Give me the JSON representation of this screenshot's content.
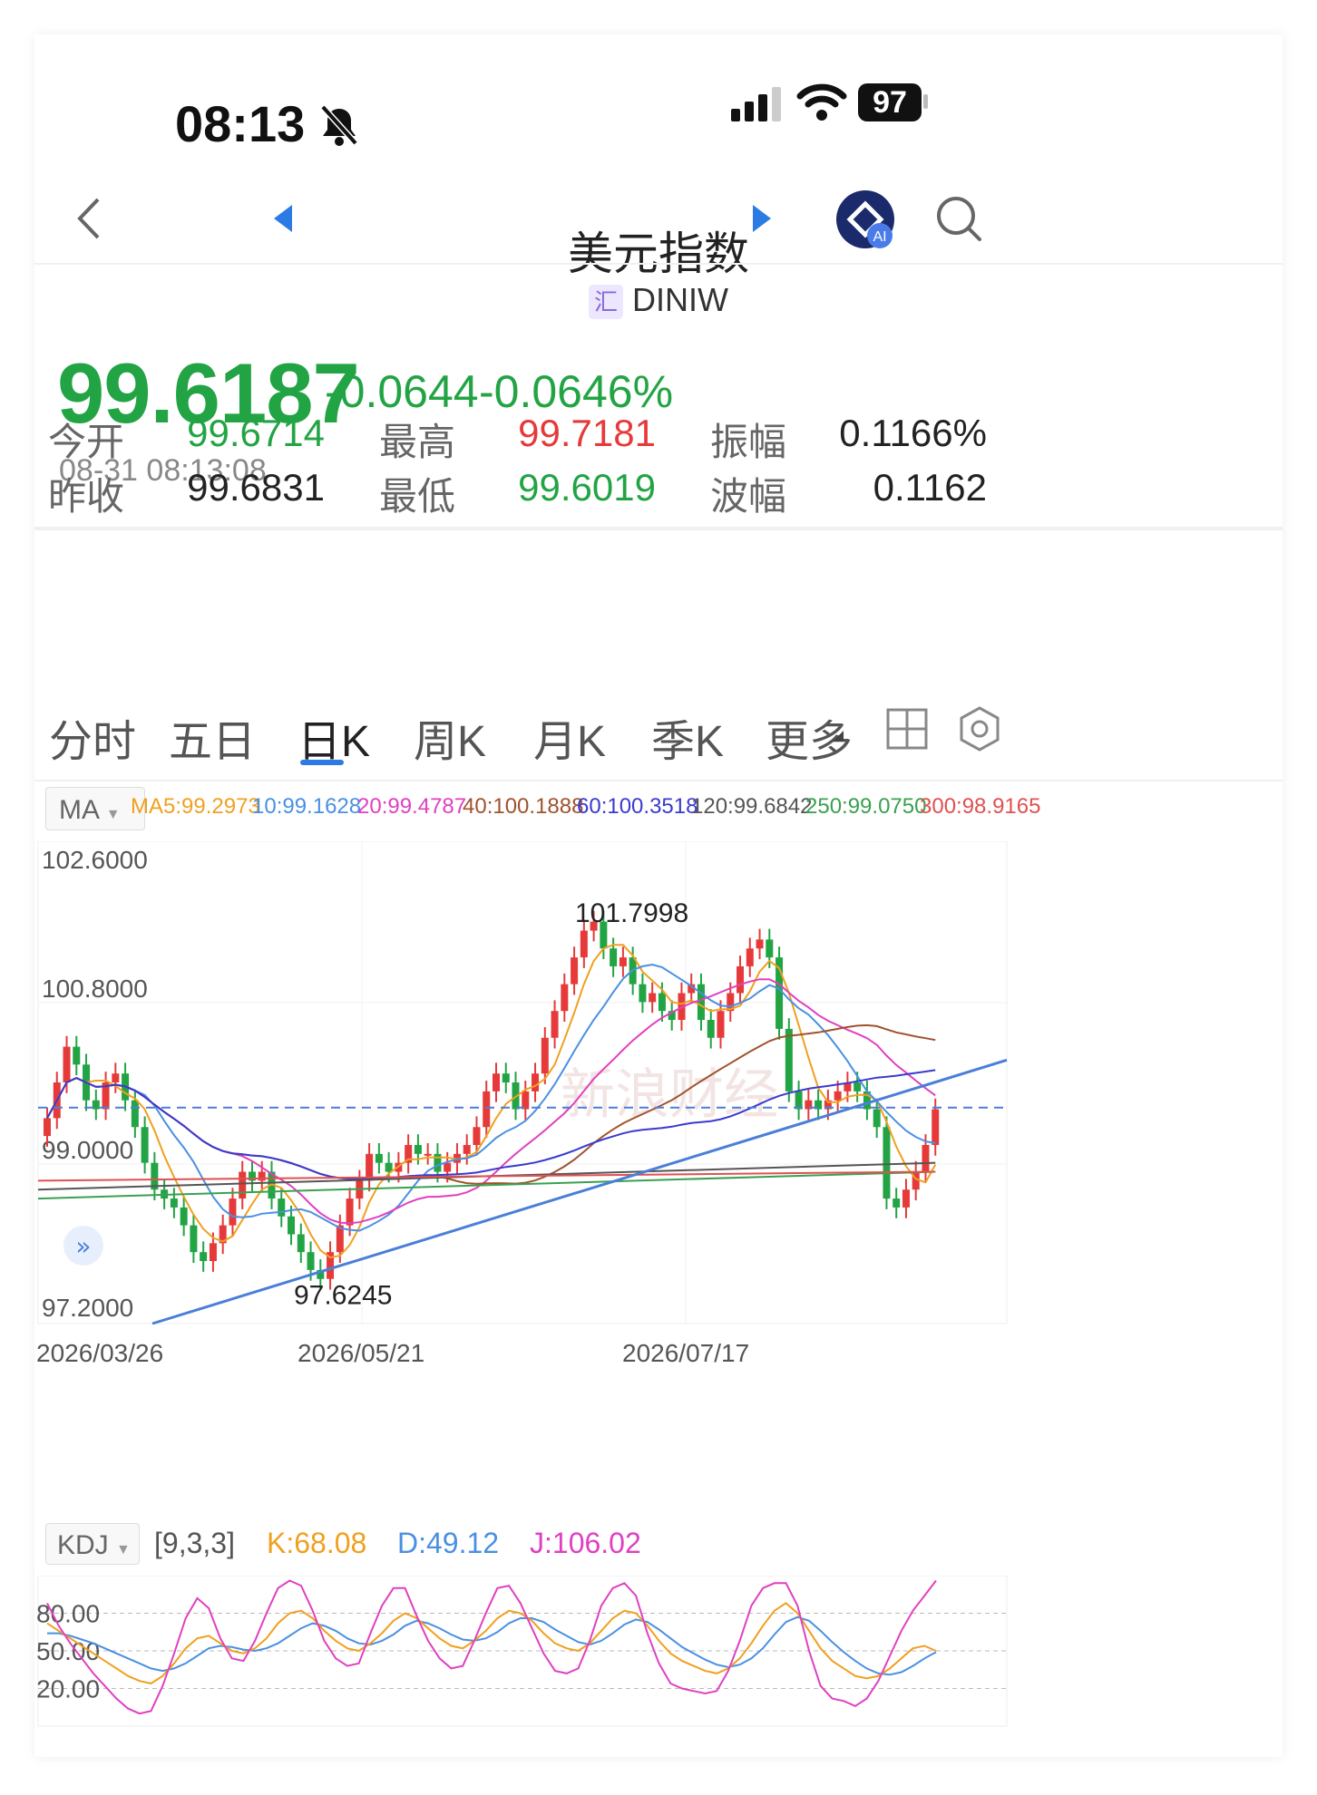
{
  "status_bar": {
    "time": "08:13",
    "battery": "97"
  },
  "header": {
    "title": "美元指数",
    "badge": "汇",
    "symbol": "DINIW"
  },
  "quote": {
    "price": "99.6187",
    "change": "-0.0644",
    "change_pct": "-0.0646%",
    "timestamp": "08-31 08:13:08",
    "stats": [
      {
        "label": "今开",
        "value": "99.6714",
        "color": "#22a444"
      },
      {
        "label": "最高",
        "value": "99.7181",
        "color": "#e63a3a"
      },
      {
        "label": "振幅",
        "value": "0.1166%",
        "color": "#222222"
      },
      {
        "label": "昨收",
        "value": "99.6831",
        "color": "#222222"
      },
      {
        "label": "最低",
        "value": "99.6019",
        "color": "#22a444"
      },
      {
        "label": "波幅",
        "value": "0.1162",
        "color": "#222222"
      }
    ]
  },
  "tabs": [
    "分时",
    "五日",
    "日K",
    "周K",
    "月K",
    "季K",
    "更多"
  ],
  "active_tab": 2,
  "ma_panel": {
    "selector": "MA",
    "entries": [
      {
        "text": "MA5:99.2973",
        "color": "#f0a020"
      },
      {
        "text": "10:99.1628",
        "color": "#4a90e2"
      },
      {
        "text": "20:99.4787",
        "color": "#e040c0"
      },
      {
        "text": "40:100.1888",
        "color": "#a0522d"
      },
      {
        "text": "60:100.3518",
        "color": "#3a3ad0"
      },
      {
        "text": "120:99.6842",
        "color": "#555555"
      },
      {
        "text": "250:99.0750",
        "color": "#3aa050"
      },
      {
        "text": "300:98.9165",
        "color": "#e05050"
      }
    ]
  },
  "kdj_panel": {
    "selector": "KDJ",
    "params": "[9,3,3]",
    "K": "K:68.08",
    "D": "D:49.12",
    "J": "J:106.02",
    "colors": {
      "K": "#f0a020",
      "D": "#4a90e2",
      "J": "#e040c0"
    }
  },
  "chart_data": [
    {
      "type": "candlestick",
      "title": "",
      "y_ticks": [
        "102.6000",
        "100.8000",
        "99.0000",
        "97.2000"
      ],
      "ylim": [
        97.2,
        102.6
      ],
      "x_ticks": [
        "2026/03/26",
        "2026/05/21",
        "2026/07/17"
      ],
      "annotations": {
        "high": "101.7998",
        "low": "97.6245"
      },
      "reference_line": 99.6187,
      "watermark": "新浪财经",
      "close": [
        99.5,
        99.9,
        100.3,
        100.1,
        99.7,
        99.6,
        99.9,
        100.0,
        99.7,
        99.4,
        99.0,
        98.7,
        98.6,
        98.5,
        98.3,
        98.0,
        97.9,
        98.1,
        98.3,
        98.6,
        98.9,
        98.8,
        98.9,
        98.6,
        98.4,
        98.2,
        98.0,
        97.8,
        97.7,
        98.0,
        98.3,
        98.6,
        98.8,
        99.1,
        99.0,
        98.9,
        99.0,
        99.2,
        99.1,
        99.1,
        98.9,
        99.0,
        99.1,
        99.2,
        99.4,
        99.8,
        100.0,
        99.9,
        99.6,
        99.8,
        100.0,
        100.4,
        100.7,
        101.0,
        101.3,
        101.6,
        101.7,
        101.4,
        101.2,
        101.3,
        101.0,
        100.8,
        100.9,
        100.7,
        100.6,
        100.9,
        101.0,
        100.6,
        100.4,
        100.7,
        100.9,
        101.2,
        101.4,
        101.5,
        101.3,
        100.5,
        99.8,
        99.6,
        99.7,
        99.6,
        99.7,
        99.8,
        99.9,
        99.8,
        99.6,
        99.4,
        98.6,
        98.5,
        98.7,
        98.9,
        99.2,
        99.6
      ],
      "kdj": {
        "K": [
          72,
          66,
          60,
          54,
          48,
          42,
          36,
          30,
          26,
          24,
          30,
          40,
          52,
          60,
          62,
          56,
          50,
          48,
          52,
          60,
          72,
          80,
          82,
          76,
          66,
          58,
          52,
          50,
          56,
          64,
          74,
          80,
          76,
          68,
          60,
          54,
          52,
          58,
          66,
          76,
          82,
          80,
          74,
          64,
          56,
          52,
          50,
          56,
          66,
          76,
          82,
          80,
          70,
          58,
          48,
          42,
          38,
          34,
          32,
          36,
          44,
          56,
          70,
          82,
          88,
          80,
          66,
          52,
          42,
          36,
          30,
          28,
          30,
          36,
          44,
          52,
          54,
          50
        ],
        "D": [
          64,
          64,
          62,
          59,
          56,
          52,
          48,
          44,
          40,
          36,
          34,
          36,
          40,
          46,
          52,
          54,
          53,
          51,
          50,
          52,
          56,
          62,
          68,
          72,
          70,
          66,
          60,
          56,
          55,
          58,
          63,
          70,
          74,
          72,
          68,
          63,
          59,
          58,
          60,
          65,
          72,
          76,
          76,
          73,
          67,
          62,
          57,
          55,
          58,
          64,
          71,
          75,
          73,
          67,
          60,
          53,
          48,
          43,
          39,
          37,
          39,
          44,
          52,
          63,
          73,
          77,
          74,
          66,
          57,
          49,
          42,
          36,
          32,
          31,
          33,
          38,
          44,
          49
        ],
        "J": [
          88,
          70,
          56,
          44,
          32,
          22,
          12,
          4,
          0,
          2,
          22,
          48,
          76,
          92,
          84,
          60,
          44,
          42,
          58,
          80,
          100,
          106,
          102,
          82,
          58,
          44,
          38,
          40,
          64,
          86,
          100,
          100,
          78,
          58,
          44,
          36,
          38,
          58,
          80,
          100,
          102,
          88,
          68,
          48,
          34,
          32,
          36,
          58,
          86,
          100,
          104,
          94,
          64,
          40,
          24,
          20,
          18,
          16,
          18,
          34,
          58,
          86,
          100,
          104,
          104,
          86,
          50,
          22,
          12,
          10,
          6,
          12,
          26,
          46,
          66,
          82,
          94,
          106
        ]
      }
    },
    {
      "type": "line",
      "title": "KDJ",
      "y_ticks": [
        "80.00",
        "50.00",
        "20.00"
      ]
    }
  ]
}
